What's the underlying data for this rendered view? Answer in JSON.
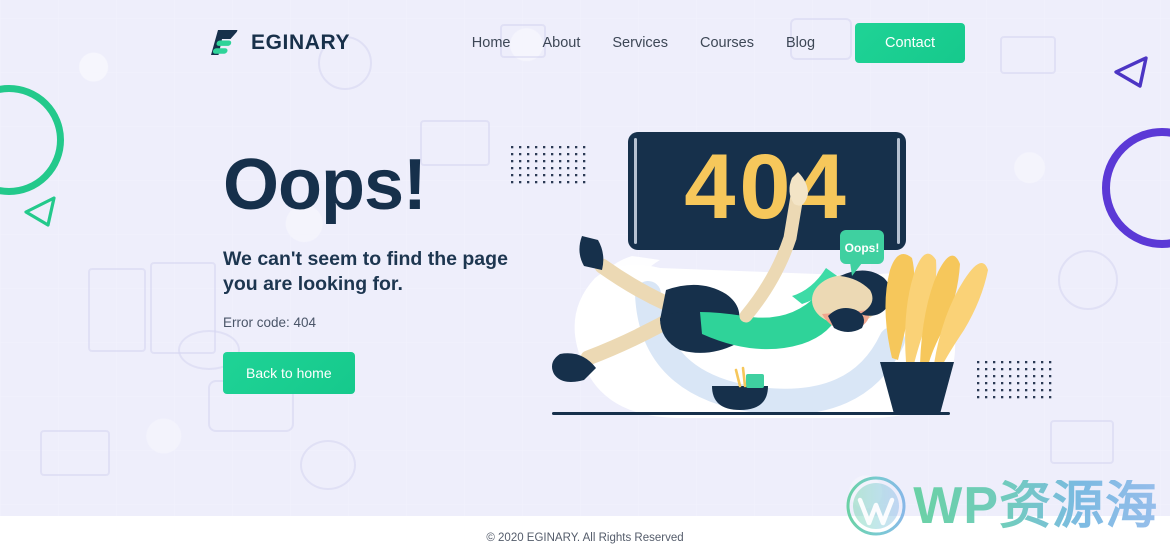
{
  "brand": {
    "name": "EGINARY",
    "logo_icon": "eginary-e-logo"
  },
  "nav": {
    "items": [
      {
        "label": "Home"
      },
      {
        "label": "About"
      },
      {
        "label": "Services"
      },
      {
        "label": "Courses"
      },
      {
        "label": "Blog"
      }
    ],
    "cta": {
      "label": "Contact",
      "color": "#19cd90"
    }
  },
  "hero": {
    "headline": "Oops!",
    "subtext_line1": "We can't seem to find the page",
    "subtext_line2": "you are looking for.",
    "error_code": "Error code: 404",
    "button": {
      "label": "Back to home",
      "color": "#19cd90"
    }
  },
  "illustration": {
    "board_text": "404",
    "board_color": "#16304b",
    "board_text_color": "#f6c75b",
    "bubble_text": "Oops!",
    "bubble_color": "#3fd0a0",
    "accent_green": "#2fd399",
    "accent_yellow": "#f6c75b",
    "skin_color": "#ecd9b4"
  },
  "decorations": {
    "ring_green_color": "#23c98b",
    "ring_purple_color": "#5b39d6",
    "triangle_green_color": "#23c98b",
    "triangle_purple_color": "#4c35c4",
    "dot_color": "#2b3a55",
    "background_color": "#eeeefb"
  },
  "watermark": {
    "text": "WP资源海",
    "logo_icon": "wordpress-logo"
  },
  "footer": {
    "copyright": "© 2020 EGINARY. All Rights Reserved"
  }
}
